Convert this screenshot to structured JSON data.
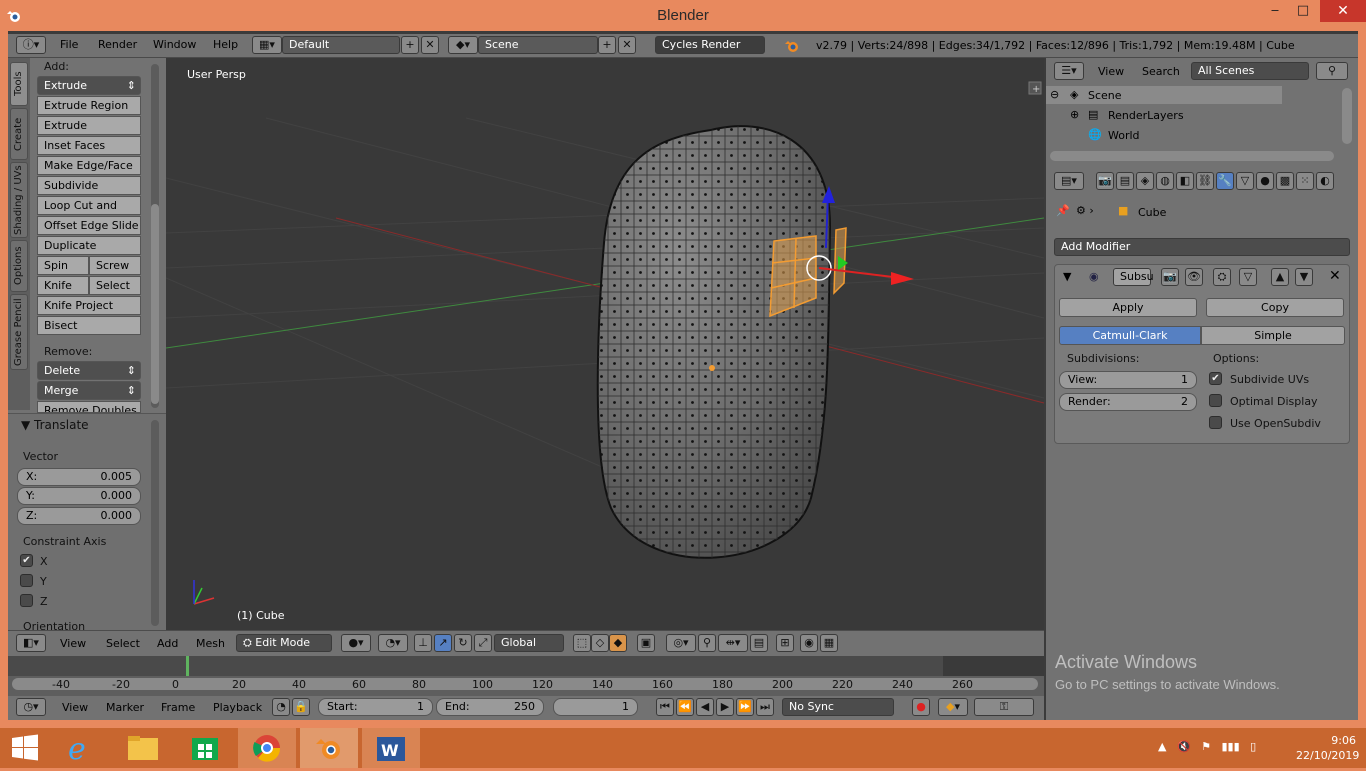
{
  "window": {
    "title": "Blender",
    "minimize": "‒",
    "maximize": "□",
    "close": "✕"
  },
  "topbar": {
    "menus": [
      "File",
      "Render",
      "Window",
      "Help"
    ],
    "layout": "Default",
    "scene": "Scene",
    "engine": "Cycles Render",
    "stats": "v2.79 | Verts:24/898 | Edges:34/1,792 | Faces:12/896 | Tris:1,792 | Mem:19.48M | Cube"
  },
  "tool_tabs": [
    "Tools",
    "Create",
    "Shading / UVs",
    "Options",
    "Grease Pencil"
  ],
  "tools": {
    "add_label": "Add:",
    "extrude": "Extrude",
    "buttons": [
      "Extrude Region",
      "Extrude Individual",
      "Inset Faces",
      "Make Edge/Face",
      "Subdivide",
      "Loop Cut and Slide",
      "Offset Edge Slide",
      "Duplicate"
    ],
    "spin": "Spin",
    "screw": "Screw",
    "knife": "Knife",
    "select": "Select",
    "knife_project": "Knife Project",
    "bisect": "Bisect",
    "remove_label": "Remove:",
    "delete": "Delete",
    "merge": "Merge",
    "remove_doubles": "Remove Doubles"
  },
  "translate": {
    "title": "Translate",
    "vector_label": "Vector",
    "x_label": "X:",
    "x": "0.005",
    "y_label": "Y:",
    "y": "0.000",
    "z_label": "Z:",
    "z": "0.000",
    "constraint_label": "Constraint Axis",
    "cx": "X",
    "cy": "Y",
    "cz": "Z",
    "cx_checked": true,
    "cy_checked": false,
    "cz_checked": false,
    "orientation_label": "Orientation"
  },
  "viewport": {
    "view_name": "User Persp",
    "object_label": "(1) Cube"
  },
  "viewport_header": {
    "menus": [
      "View",
      "Select",
      "Add",
      "Mesh"
    ],
    "mode": "Edit Mode",
    "orientation": "Global"
  },
  "timeline": {
    "ticks": [
      "-40",
      "-20",
      "0",
      "20",
      "40",
      "60",
      "80",
      "100",
      "120",
      "140",
      "160",
      "180",
      "200",
      "220",
      "240",
      "260"
    ]
  },
  "timeline_header": {
    "menus": [
      "View",
      "Marker",
      "Frame",
      "Playback"
    ],
    "start_label": "Start:",
    "start": "1",
    "end_label": "End:",
    "end": "250",
    "current": "1",
    "sync": "No Sync"
  },
  "outliner": {
    "view": "View",
    "search": "Search",
    "filter": "All Scenes",
    "items": [
      "Scene",
      "RenderLayers",
      "World"
    ]
  },
  "properties": {
    "object": "Cube",
    "add_modifier": "Add Modifier",
    "modifier_name": "Subsu",
    "apply": "Apply",
    "copy": "Copy",
    "catmull": "Catmull-Clark",
    "simple": "Simple",
    "subdiv_label": "Subdivisions:",
    "options_label": "Options:",
    "view_label": "View:",
    "view_value": "1",
    "render_label": "Render:",
    "render_value": "2",
    "opt1": "Subdivide UVs",
    "opt2": "Optimal Display",
    "opt3": "Use OpenSubdiv",
    "opt1_checked": true,
    "opt2_checked": false,
    "opt3_checked": false
  },
  "watermark": {
    "title": "Activate Windows",
    "subtitle": "Go to PC settings to activate Windows."
  },
  "taskbar": {
    "time": "9:06",
    "date": "22/10/2019"
  },
  "colors": {
    "accent": "#e8895e",
    "selection": "#f39c32",
    "active_blue": "#5680c2"
  }
}
